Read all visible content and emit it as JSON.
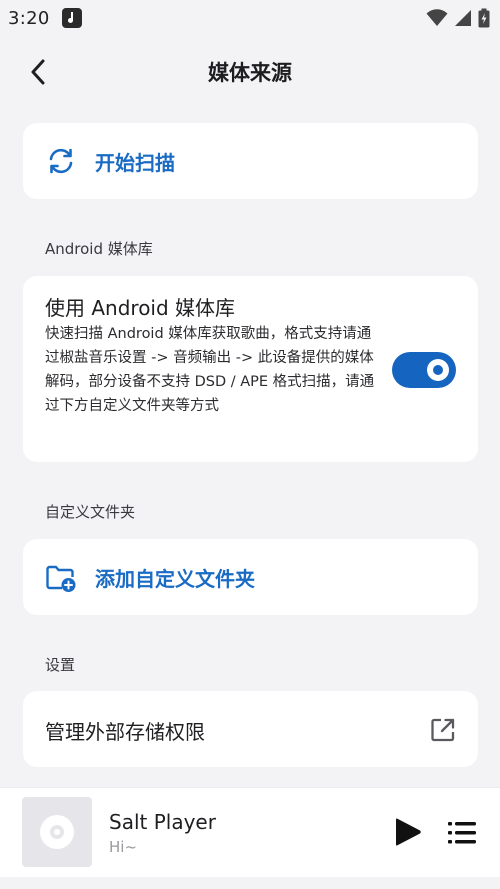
{
  "status_bar": {
    "time": "3:20"
  },
  "top_bar": {
    "title": "媒体来源"
  },
  "scan": {
    "label": "开始扫描"
  },
  "android_section": {
    "header": "Android 媒体库",
    "card_title": "使用 Android 媒体库",
    "description": "快速扫描 Android 媒体库获取歌曲，格式支持请通过椒盐音乐设置 -> 音频输出 -> 此设备提供的媒体解码，部分设备不支持 DSD / APE 格式扫描，请通过下方自定义文件夹等方式",
    "toggle_on": true
  },
  "custom_folder_section": {
    "header": "自定义文件夹",
    "add_label": "添加自定义文件夹"
  },
  "settings_section": {
    "header": "设置",
    "manage_label": "管理外部存储权限"
  },
  "player": {
    "title": "Salt Player",
    "subtitle": "Hi~"
  },
  "colors": {
    "accent": "#1a6bc4",
    "switch_track": "#1565c0",
    "background": "#f3f3f6",
    "card": "#ffffff"
  },
  "icons": {
    "back": "arrow-back-icon",
    "scan": "sync-icon",
    "add_folder": "folder-add-icon",
    "external": "open-in-new-icon",
    "play": "play-icon",
    "queue": "queue-list-icon"
  }
}
